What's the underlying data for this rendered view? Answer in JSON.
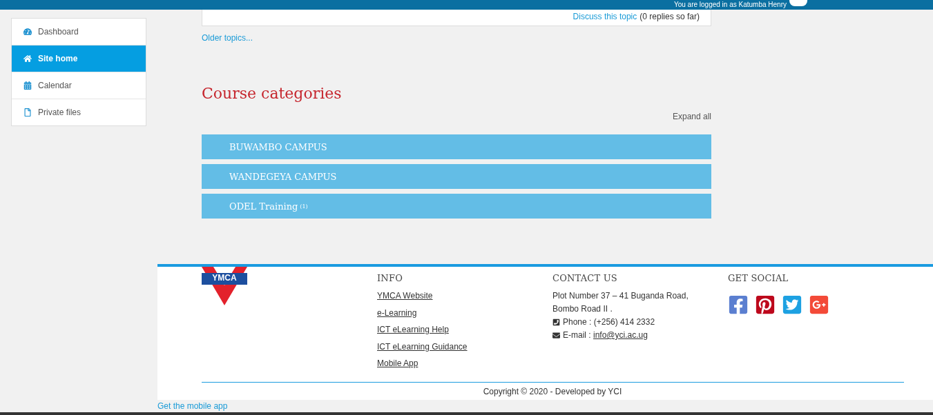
{
  "header": {
    "login_text": "You are logged in as Katumba Henry"
  },
  "sidebar": {
    "items": [
      {
        "label": "Dashboard",
        "selected": false
      },
      {
        "label": "Site home",
        "selected": true
      },
      {
        "label": "Calendar",
        "selected": false
      },
      {
        "label": "Private files",
        "selected": false
      }
    ]
  },
  "forum_post": {
    "link": "Discuss this topic",
    "replies": "(0 replies so far)"
  },
  "older_topics": "Older topics...",
  "course_categories": {
    "title": "Course categories",
    "expand_all": "Expand all",
    "items": [
      {
        "name": "BUWAMBO CAMPUS"
      },
      {
        "name": "WANDEGEYA CAMPUS"
      },
      {
        "name": "ODEL Training",
        "count": "(1)"
      }
    ]
  },
  "footer": {
    "logo_text": "YMCA",
    "info": {
      "title": "INFO",
      "links": [
        "YMCA Website",
        "e-Learning",
        "ICT eLearning Help",
        "ICT eLearning Guidance",
        "Mobile App"
      ]
    },
    "contact": {
      "title": "CONTACT US",
      "address": [
        "Plot Number 37 – 41 Buganda Road,",
        "Bombo Road II ."
      ],
      "phone": "Phone : (+256) 414 2332",
      "email_label": "E-mail :",
      "email": "info@yci.ac.ug"
    },
    "social": {
      "title": "GET SOCIAL",
      "icons": [
        {
          "kind": "facebook",
          "color": "#5b7fd0"
        },
        {
          "kind": "pinterest",
          "color": "#bd081c"
        },
        {
          "kind": "twitter",
          "color": "#1da1e2"
        },
        {
          "kind": "googleplus",
          "color": "#f34a38"
        }
      ]
    },
    "copyright": "Copyright © 2020 - Developed by YCI"
  },
  "mobile_app_link": "Get the mobile app"
}
